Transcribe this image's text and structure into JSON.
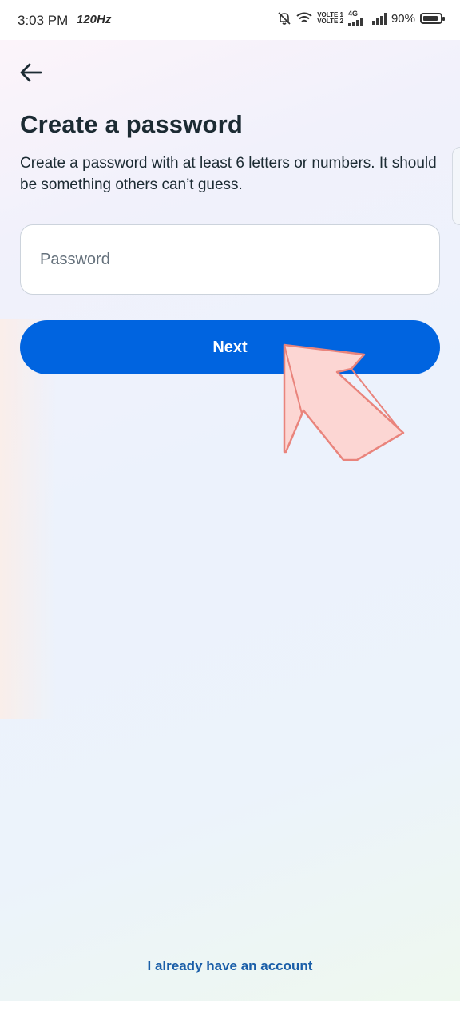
{
  "status_bar": {
    "time": "3:03 PM",
    "refresh_rate": "120Hz",
    "volte_1": "VOLTE 1",
    "volte_2": "VOLTE 2",
    "network": "4G",
    "battery_percent": "90%",
    "battery_level": 0.9,
    "icons": [
      "notifications-off-icon",
      "wifi-icon",
      "signal-icon",
      "signal-icon",
      "battery-icon"
    ]
  },
  "header": {
    "back_icon": "arrow-left-icon",
    "title": "Create a password",
    "description": "Create a password with at least 6 letters or numbers. It should be something others can’t guess."
  },
  "form": {
    "password_value": "",
    "password_placeholder": "Password",
    "next_label": "Next"
  },
  "footer": {
    "login_link": "I already have an account"
  },
  "colors": {
    "primary": "#0064e0",
    "text": "#1c2b33",
    "link": "#1a5ea8",
    "pointer_fill": "#fcd6d3",
    "pointer_stroke": "#e9847c"
  }
}
